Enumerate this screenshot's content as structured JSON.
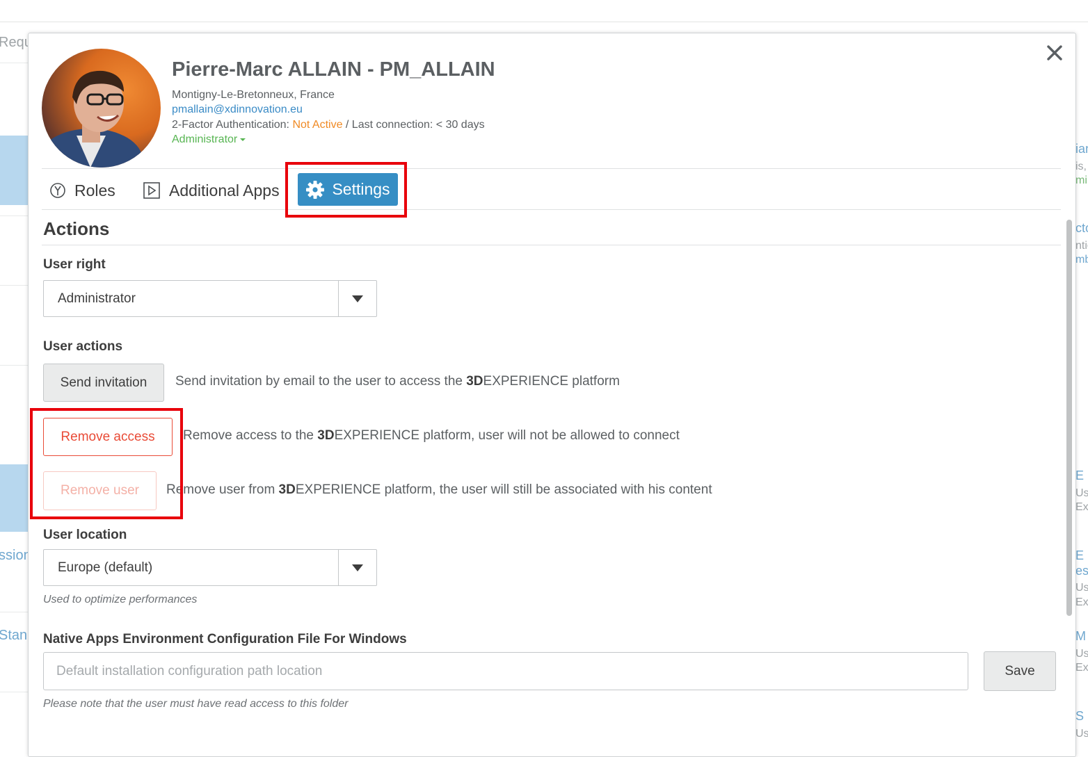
{
  "background": {
    "left_texts": [
      "Requ",
      "ssion",
      "Stan"
    ],
    "right_texts": [
      "ian",
      "is,",
      "min",
      "cto",
      "ntio",
      "mb",
      "E",
      "Us",
      "Exp",
      "E",
      "esi",
      "Us",
      "Exp",
      "M",
      "Us",
      "Exp",
      "S",
      "Us"
    ]
  },
  "user": {
    "name": "Pierre-Marc ALLAIN - PM_ALLAIN",
    "location": "Montigny-Le-Bretonneux, France",
    "email": "pmallain@xdinnovation.eu",
    "twofa_label": "2-Factor Authentication: ",
    "twofa_status": "Not Active",
    "last_connection": " / Last connection: < 30 days",
    "role": "Administrator"
  },
  "tabs": {
    "roles": "Roles",
    "additional_apps": "Additional Apps",
    "settings": "Settings"
  },
  "actions": {
    "title": "Actions",
    "user_right_label": "User right",
    "user_right_value": "Administrator",
    "user_actions_label": "User actions",
    "send_invitation": "Send invitation",
    "send_invitation_desc_pre": "Send invitation by email to the user to access the ",
    "send_invitation_desc_bold": "3D",
    "send_invitation_desc_post": "EXPERIENCE platform",
    "remove_access": "Remove access",
    "remove_access_desc_pre": "Remove access to the ",
    "remove_access_desc_bold": "3D",
    "remove_access_desc_post": "EXPERIENCE platform, user will not be allowed to connect",
    "remove_user": "Remove user",
    "remove_user_desc_pre": "Remove user from ",
    "remove_user_desc_bold": "3D",
    "remove_user_desc_post": "EXPERIENCE platform, the user will still be associated with his content",
    "user_location_label": "User location",
    "user_location_value": "Europe (default)",
    "user_location_hint": "Used to optimize performances",
    "native_apps_label": "Native Apps Environment Configuration File For Windows",
    "native_apps_placeholder": "Default installation configuration path location",
    "save": "Save",
    "native_apps_hint": "Please note that the user must have read access to this folder"
  },
  "colors": {
    "accent": "#368ec4",
    "danger": "#e94b37",
    "warning": "#f08a24",
    "success": "#57b552",
    "highlight": "#e8000b"
  },
  "icons": [
    "close-icon",
    "roles-icon",
    "additional-apps-icon",
    "gear-icon",
    "chevron-down-icon"
  ]
}
